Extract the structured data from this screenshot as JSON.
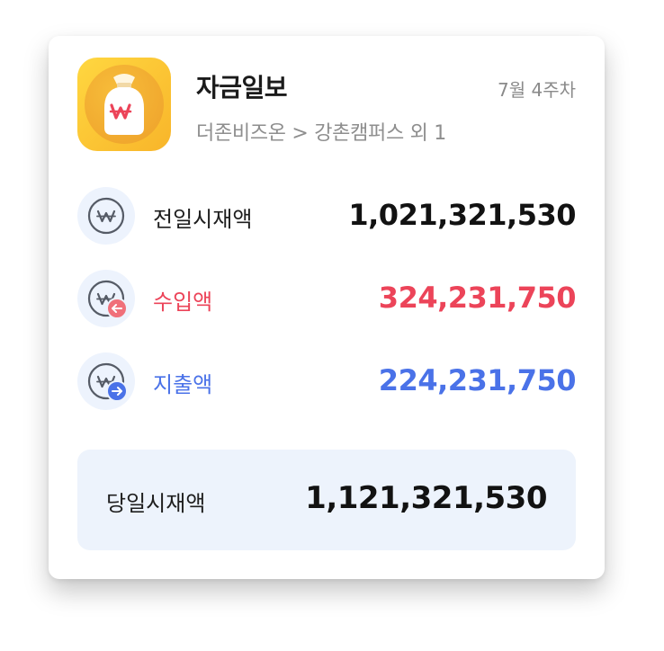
{
  "header": {
    "title": "자금일보",
    "period": "7월 4주차",
    "breadcrumb": "더존비즈온 > 강촌캠퍼스 외 1"
  },
  "app_icon": {
    "name": "money-bag-icon",
    "symbol": "₩"
  },
  "rows": [
    {
      "label": "전일시재액",
      "amount": "1,021,321,530",
      "icon": "won-coin-icon"
    },
    {
      "label": "수입액",
      "amount": "324,231,750",
      "icon": "won-coin-income-icon",
      "color": "#ec4459"
    },
    {
      "label": "지출액",
      "amount": "224,231,750",
      "icon": "won-coin-expense-icon",
      "color": "#4a72e8"
    }
  ],
  "total": {
    "label": "당일시재액",
    "amount": "1,121,321,530"
  },
  "colors": {
    "income": "#ec4459",
    "expense": "#4a72e8",
    "icon_bg_gradient_start": "#ffd740",
    "icon_bg_gradient_end": "#f8b52a",
    "summary_bg": "#edf3fc"
  }
}
